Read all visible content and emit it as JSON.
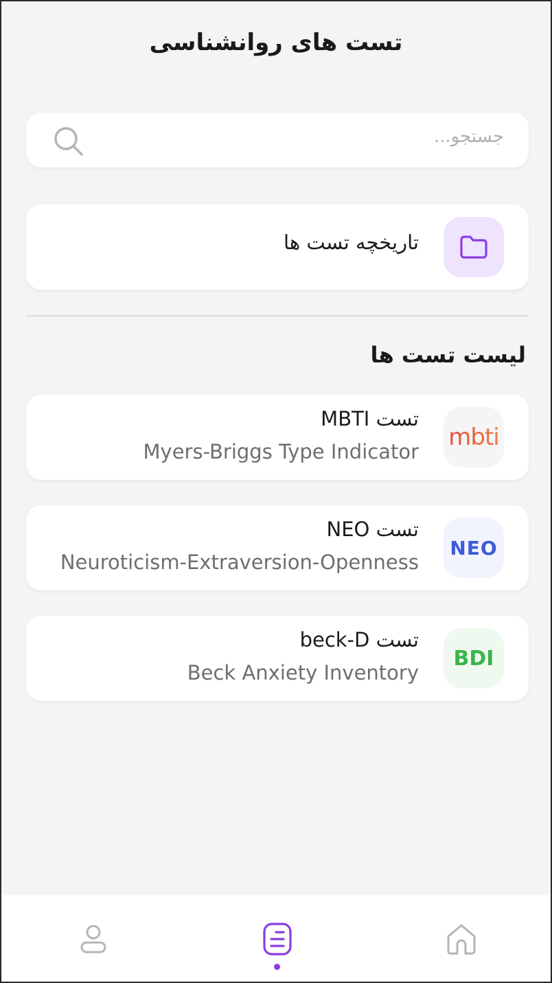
{
  "header": {
    "title": "تست های روانشناسی"
  },
  "search": {
    "placeholder": "جستجو..."
  },
  "history": {
    "label": "تاریخچه تست ها",
    "icon": "folder-icon",
    "accent": "#8a3ee0"
  },
  "section": {
    "title": "لیست تست ها"
  },
  "tests": [
    {
      "title": "تست MBTI",
      "subtitle": "Myers-Briggs Type Indicator",
      "logo_text": "mbti",
      "logo_bg": "#f5f5f5"
    },
    {
      "title": "تست NEO",
      "subtitle": "Neuroticism-Extraversion-Openness",
      "logo_text": "NEO",
      "logo_bg": "#f1f4fd"
    },
    {
      "title": "تست beck-D",
      "subtitle": "Beck Anxiety Inventory",
      "logo_text": "BDI",
      "logo_bg": "#f0f9f0"
    }
  ],
  "nav": {
    "items": [
      {
        "icon": "profile-icon",
        "active": false
      },
      {
        "icon": "tests-list-icon",
        "active": true
      },
      {
        "icon": "home-icon",
        "active": false
      }
    ],
    "active_color": "#8a3ee0",
    "inactive_color": "#b5b5b5"
  }
}
